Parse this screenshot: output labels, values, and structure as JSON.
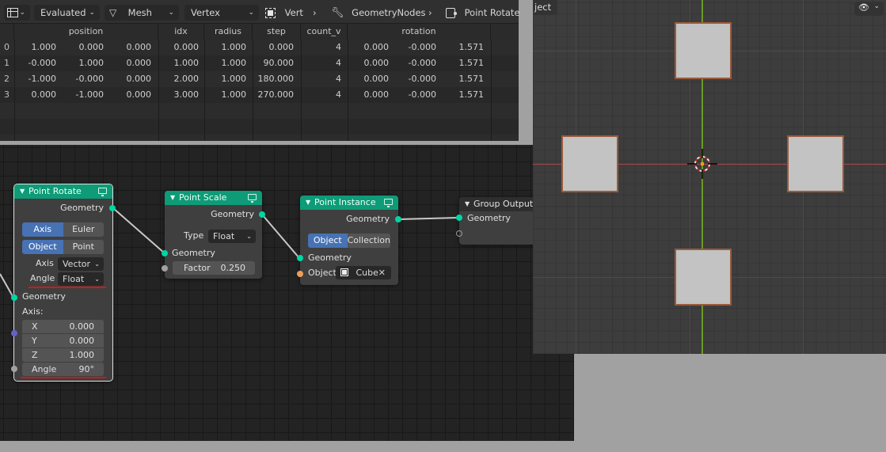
{
  "spreadsheet": {
    "header": {
      "editor_type_icon": "spreadsheet-icon",
      "evaluation_mode": "Evaluated",
      "component": "Mesh",
      "component_icon": "mesh-icon",
      "domain": "Vertex",
      "selection_filter_label": "Vert",
      "selection_icon": "selected-only-icon",
      "breadcrumb": [
        {
          "label": "GeometryNodes",
          "icon": "wrench-icon"
        },
        {
          "label": "Point Rotate",
          "icon": "node-icon"
        }
      ]
    },
    "columns": [
      "position",
      "idx",
      "radius",
      "step",
      "count_v",
      "rotation"
    ],
    "rows": [
      {
        "index": "0",
        "position": [
          "1.000",
          "0.000",
          "0.000"
        ],
        "idx": "0.000",
        "radius": "1.000",
        "step": "0.000",
        "count_v": "4",
        "rotation": [
          "0.000",
          "-0.000",
          "1.571"
        ]
      },
      {
        "index": "1",
        "position": [
          "-0.000",
          "1.000",
          "0.000"
        ],
        "idx": "1.000",
        "radius": "1.000",
        "step": "90.000",
        "count_v": "4",
        "rotation": [
          "0.000",
          "-0.000",
          "1.571"
        ]
      },
      {
        "index": "2",
        "position": [
          "-1.000",
          "-0.000",
          "0.000"
        ],
        "idx": "2.000",
        "radius": "1.000",
        "step": "180.000",
        "count_v": "4",
        "rotation": [
          "0.000",
          "-0.000",
          "1.571"
        ]
      },
      {
        "index": "3",
        "position": [
          "0.000",
          "-1.000",
          "0.000"
        ],
        "idx": "3.000",
        "radius": "1.000",
        "step": "270.000",
        "count_v": "4",
        "rotation": [
          "0.000",
          "-0.000",
          "1.571"
        ]
      }
    ]
  },
  "nodes": {
    "point_rotate": {
      "title": "Point Rotate",
      "output_geometry": "Geometry",
      "type_options": [
        "Axis Angle",
        "Euler"
      ],
      "type_selected": "Axis Angle",
      "space_options": [
        "Object",
        "Point"
      ],
      "space_selected": "Object",
      "axis_label": "Axis",
      "axis_value": "Vector",
      "angle_label": "Angle",
      "angle_value": "Float",
      "input_geometry": "Geometry",
      "axis_section": "Axis:",
      "axis_x_label": "X",
      "axis_x": "0.000",
      "axis_y_label": "Y",
      "axis_y": "0.000",
      "axis_z_label": "Z",
      "axis_z": "1.000",
      "angle_field_label": "Angle",
      "angle_field_value": "90°"
    },
    "point_scale": {
      "title": "Point Scale",
      "output_geometry": "Geometry",
      "type_label": "Type",
      "type_value": "Float",
      "input_geometry": "Geometry",
      "factor_label": "Factor",
      "factor_value": "0.250"
    },
    "point_instance": {
      "title": "Point Instance",
      "output_geometry": "Geometry",
      "mode_options": [
        "Object",
        "Collection"
      ],
      "mode_selected": "Object",
      "input_geometry": "Geometry",
      "object_label": "Object:",
      "object_value": "Cube"
    },
    "group_output": {
      "title": "Group Output",
      "input_geometry": "Geometry"
    }
  },
  "viewport": {
    "partial_label": "ject",
    "visibility_icon": "eye-cursor-icon",
    "cube_count": 4
  },
  "colors": {
    "node_header_geometry": "#0e9b78",
    "socket_geometry": "#00d6a3",
    "socket_vector": "#6363c7",
    "socket_float": "#a1a1a1",
    "socket_object": "#ed9e5c",
    "highlight_underline": "#d01818",
    "toggle_active": "#4772b3",
    "x_axis": "#a34848",
    "y_axis": "#6a9b24"
  }
}
